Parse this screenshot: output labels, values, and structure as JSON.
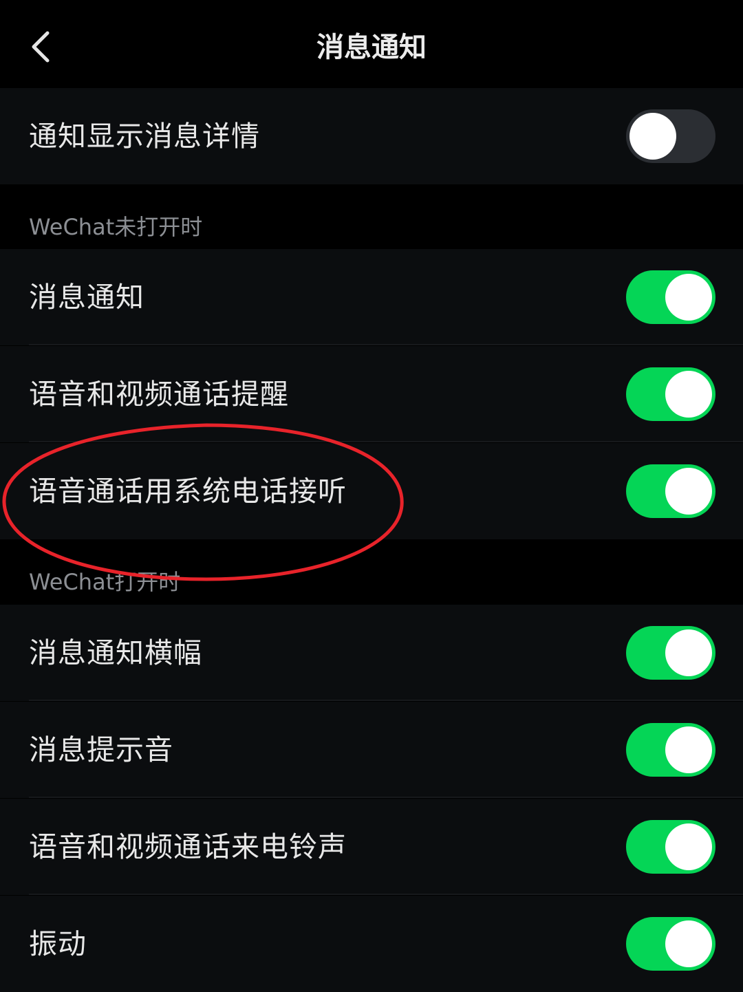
{
  "header": {
    "title": "消息通知",
    "back_icon": "chevron-left-icon"
  },
  "top_setting": {
    "label": "通知显示消息详情",
    "enabled": false
  },
  "sections": [
    {
      "header": "WeChat未打开时",
      "items": [
        {
          "label": "消息通知",
          "enabled": true
        },
        {
          "label": "语音和视频通话提醒",
          "enabled": true
        },
        {
          "label": "语音通话用系统电话接听",
          "enabled": true
        }
      ]
    },
    {
      "header": "WeChat打开时",
      "items": [
        {
          "label": "消息通知横幅",
          "enabled": true
        },
        {
          "label": "消息提示音",
          "enabled": true
        },
        {
          "label": "语音和视频通话来电铃声",
          "enabled": true
        },
        {
          "label": "振动",
          "enabled": true
        }
      ]
    }
  ],
  "colors": {
    "toggle_on": "#05d556",
    "toggle_off": "#2b2e33",
    "annotation": "#e8232a"
  }
}
